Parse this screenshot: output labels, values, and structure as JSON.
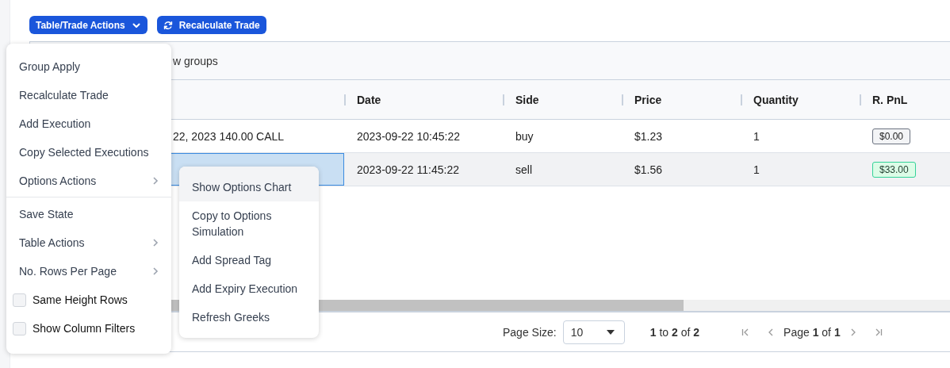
{
  "toolbar": {
    "actions_button": {
      "label": "Table/Trade Actions"
    },
    "recalculate_button": {
      "label": "Recalculate Trade"
    }
  },
  "grid": {
    "group_panel": {
      "text": "w groups"
    },
    "columns": [
      "",
      "Date",
      "Side",
      "Price",
      "Quantity",
      "R. PnL"
    ],
    "rows": [
      {
        "selected": false,
        "focused_cell": false,
        "cells": [
          "22, 2023 140.00 CALL",
          "2023-09-22 10:45:22",
          "buy",
          "$1.23",
          "1"
        ],
        "pnl": {
          "text": "$0.00",
          "kind": "neutral"
        }
      },
      {
        "selected": true,
        "focused_cell": true,
        "cells": [
          "",
          "2023-09-22 11:45:22",
          "sell",
          "$1.56",
          "1"
        ],
        "pnl": {
          "text": "$33.00",
          "kind": "positive"
        }
      }
    ],
    "pagination": {
      "page_size_label": "Page Size:",
      "page_size": "10",
      "range": "**1** to **2** of **2**",
      "page": "Page **1** of **1**"
    }
  },
  "menu": {
    "sections": [
      [
        {
          "kind": "action",
          "label": "Group Apply"
        },
        {
          "kind": "action",
          "label": "Recalculate Trade"
        },
        {
          "kind": "action",
          "label": "Add Execution"
        },
        {
          "kind": "action",
          "label": "Copy Selected Executions"
        },
        {
          "kind": "submenu",
          "label": "Options Actions"
        }
      ],
      [
        {
          "kind": "action",
          "label": "Save State"
        },
        {
          "kind": "submenu",
          "label": "Table Actions"
        },
        {
          "kind": "submenu",
          "label": "No. Rows Per Page"
        },
        {
          "kind": "checkbox",
          "label": "Same Height Rows",
          "checked": false
        },
        {
          "kind": "checkbox",
          "label": "Show Column Filters",
          "checked": false
        }
      ]
    ]
  },
  "submenu": {
    "items": [
      {
        "label": "Show Options Chart",
        "highlighted": true
      },
      {
        "label": "Copy to Options Simulation",
        "highlighted": false
      },
      {
        "label": "Add Spread Tag",
        "highlighted": false
      },
      {
        "label": "Add Expiry Execution",
        "highlighted": false
      },
      {
        "label": "Refresh Greeks",
        "highlighted": false
      }
    ]
  }
}
